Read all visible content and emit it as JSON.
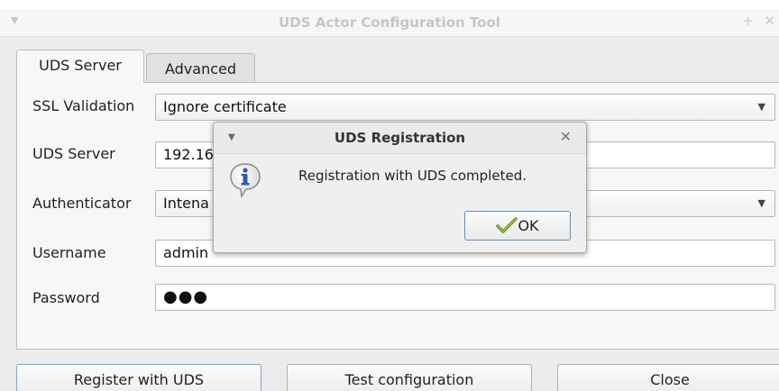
{
  "window": {
    "title": "UDS Actor Configuration Tool"
  },
  "tabs": [
    {
      "label": "UDS Server",
      "active": true
    },
    {
      "label": "Advanced",
      "active": false
    }
  ],
  "form": {
    "ssl_validation": {
      "label": "SSL Validation",
      "value": "Ignore certificate"
    },
    "uds_server": {
      "label": "UDS Server",
      "value": "192.16"
    },
    "authenticator": {
      "label": "Authenticator",
      "value": "Intena"
    },
    "username": {
      "label": "Username",
      "value": "admin"
    },
    "password": {
      "label": "Password",
      "value": "●●●"
    }
  },
  "buttons": {
    "register": "Register with UDS",
    "test": "Test configuration",
    "close": "Close"
  },
  "dialog": {
    "title": "UDS Registration",
    "message": "Registration with UDS completed.",
    "ok_label": "OK",
    "icon": "info-icon"
  },
  "colors": {
    "window_bg": "#ececec",
    "dialog_border": "#5b8fc4",
    "info_blue": "#2a5db0"
  }
}
